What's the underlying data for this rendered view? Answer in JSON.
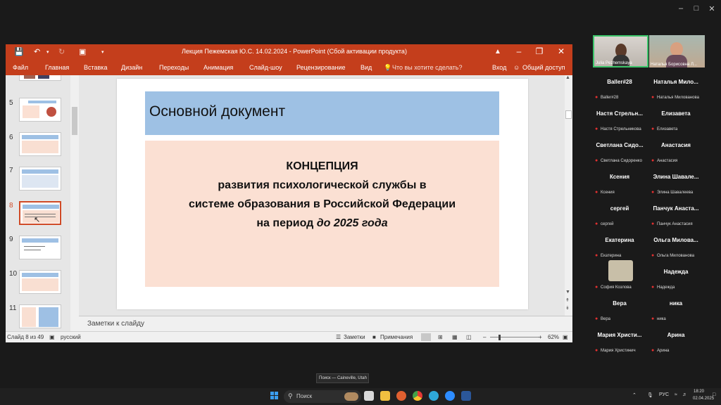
{
  "window_controls": {
    "minimize": "–",
    "maximize": "□",
    "close": "✕"
  },
  "ppt": {
    "title": "Лекция Пежемская Ю.С. 14.02.2024 - PowerPoint (Сбой активации продукта)",
    "ribbon_tabs": [
      "Файл",
      "Главная",
      "Вставка",
      "Дизайн",
      "Переходы",
      "Анимация",
      "Слайд-шоу",
      "Рецензирование",
      "Вид"
    ],
    "tell_me": "Что вы хотите сделать?",
    "signin": "Вход",
    "share": "Общий доступ",
    "slide_numbers": [
      "5",
      "6",
      "7",
      "8",
      "9",
      "10",
      "11"
    ],
    "selected_slide": "8",
    "slide": {
      "title": "Основной документ",
      "line1": "КОНЦЕПЦИЯ",
      "line2": "развития психологической службы в",
      "line3": "системе образования в Российской Федерации",
      "line4_regular": "на период ",
      "line4_italic": "до 2025 года"
    },
    "notes_placeholder": "Заметки к слайду",
    "status": {
      "slide_count": "Слайд 8 из 49",
      "language": "русский",
      "notes_btn": "Заметки",
      "comments_btn": "Примечания",
      "zoom": "62%"
    }
  },
  "participants": {
    "videos": [
      {
        "name": "Julia Pezhemskaya"
      },
      {
        "name": "Наталья Борисовна Л..."
      }
    ],
    "tiles": [
      {
        "big": "Baller#28",
        "small": "Baller#28"
      },
      {
        "big": "Наталья Мило...",
        "small": "Наталья Милованова"
      },
      {
        "big": "Настя Стрельн...",
        "small": "Настя Стрельникова"
      },
      {
        "big": "Елизавета",
        "small": "Елизавета"
      },
      {
        "big": "Светлана Сидо...",
        "small": "Светлана Сидоренко"
      },
      {
        "big": "Анастасия",
        "small": "Анастасия"
      },
      {
        "big": "Ксения",
        "small": "Ксения"
      },
      {
        "big": "Элина Шавале...",
        "small": "Элина Шавалеева"
      },
      {
        "big": "сергей",
        "small": "сергей"
      },
      {
        "big": "Панчук Анаста...",
        "small": "Панчук Анастасия"
      },
      {
        "big": "Екатерина",
        "small": "Екатерина"
      },
      {
        "big": "Ольга Милова...",
        "small": "Ольга Милованова"
      },
      {
        "big": "",
        "small": "София Козлова"
      },
      {
        "big": "Надежда",
        "small": "Надежда"
      },
      {
        "big": "Вера",
        "small": "Вера"
      },
      {
        "big": "ника",
        "small": "ника"
      },
      {
        "big": "Мария Христи...",
        "small": "Мария Христинич"
      },
      {
        "big": "Арина",
        "small": "Арина"
      }
    ]
  },
  "tooltip": "Поиск — Caineville, Utah",
  "taskbar": {
    "search": "Поиск",
    "lang": "РУС",
    "time": "18:20",
    "date": "02.04.2025"
  }
}
